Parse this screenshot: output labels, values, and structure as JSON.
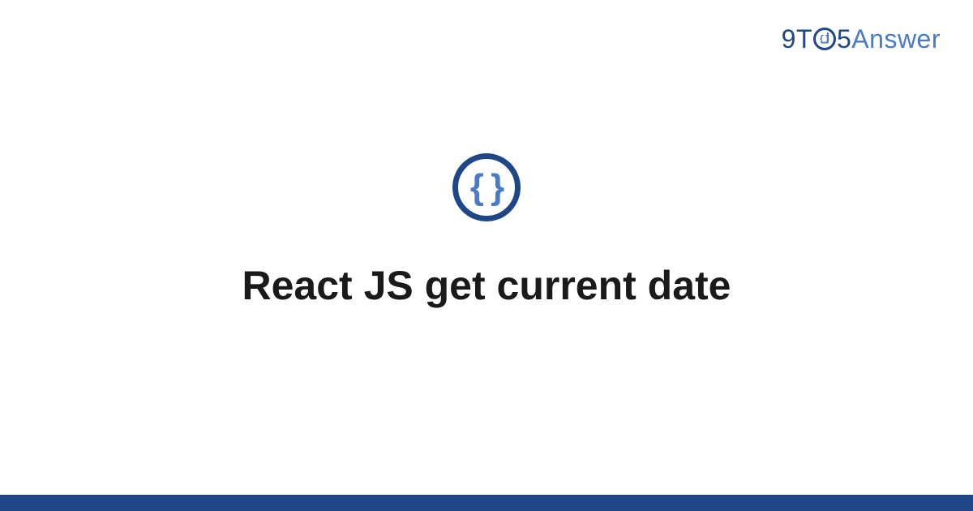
{
  "logo": {
    "prefix": "9T",
    "middle_glyph": "{}",
    "suffix_num": "5",
    "suffix_word": "Answer"
  },
  "icon": {
    "glyph": "{ }",
    "name": "code-braces-icon"
  },
  "title": "React JS get current date",
  "colors": {
    "dark_blue": "#1f4788",
    "light_blue": "#4a7bc4",
    "text": "#1a1a1a",
    "bg": "#ffffff"
  }
}
